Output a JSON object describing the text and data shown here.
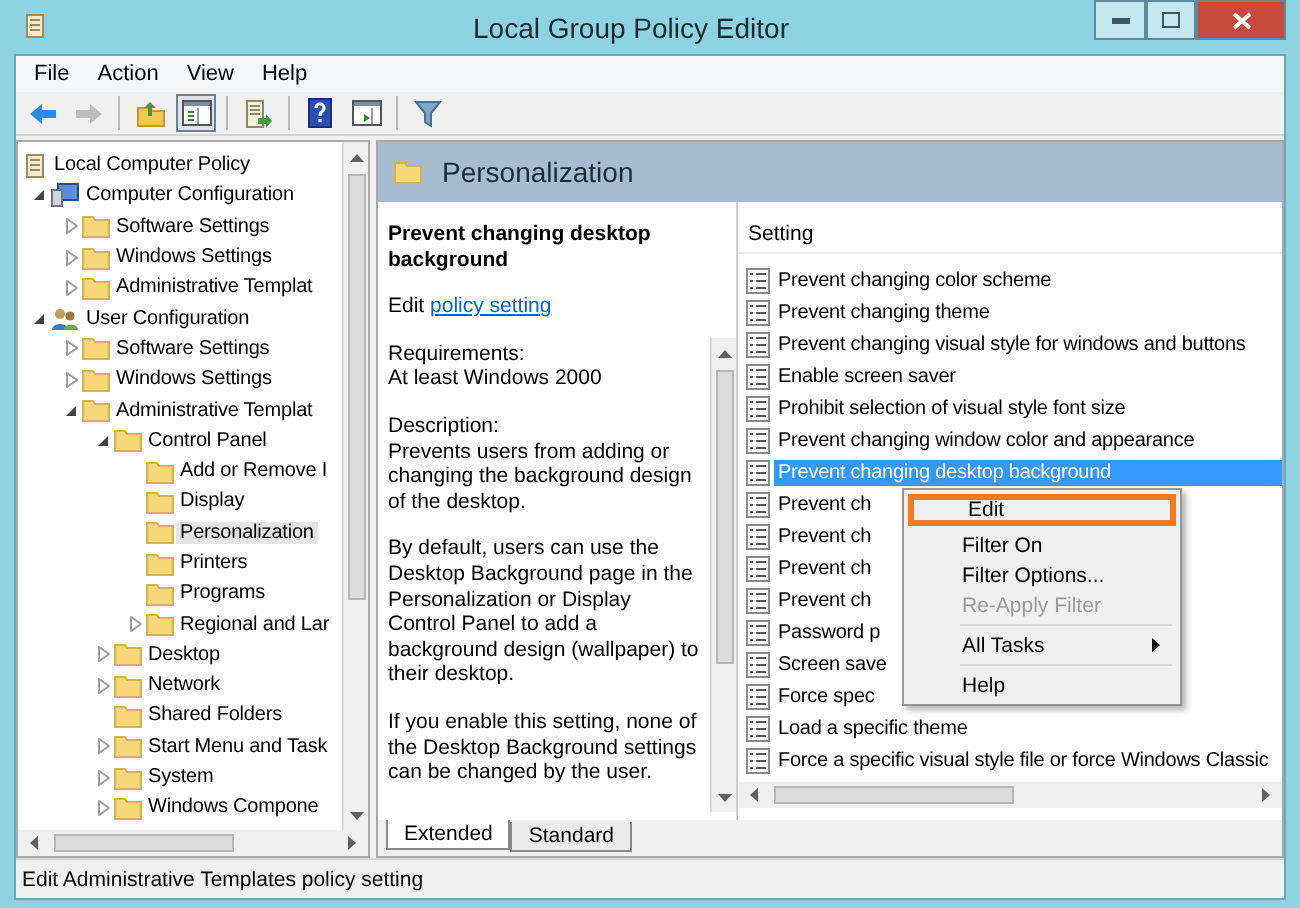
{
  "window": {
    "title": "Local Group Policy Editor"
  },
  "menu_bar": [
    "File",
    "Action",
    "View",
    "Help"
  ],
  "toolbar": [
    {
      "kind": "back",
      "disabled": false
    },
    {
      "kind": "forward",
      "disabled": true
    },
    {
      "kind": "separator"
    },
    {
      "kind": "up",
      "disabled": false
    },
    {
      "kind": "tree",
      "disabled": false,
      "selected": true
    },
    {
      "kind": "separator"
    },
    {
      "kind": "export",
      "disabled": false
    },
    {
      "kind": "separator"
    },
    {
      "kind": "help",
      "disabled": false
    },
    {
      "kind": "pane",
      "disabled": false
    },
    {
      "kind": "separator"
    },
    {
      "kind": "filter",
      "disabled": false
    }
  ],
  "tree": [
    {
      "label": "Local Computer Policy",
      "kind": "policy",
      "selected": false,
      "children": [
        {
          "label": "Computer Configuration",
          "kind": "computer",
          "expanded": true,
          "selected": false,
          "children": [
            {
              "label": "Software Settings",
              "kind": "folder",
              "expanded": false,
              "selected": false
            },
            {
              "label": "Windows Settings",
              "kind": "folder",
              "expanded": false,
              "selected": false
            },
            {
              "label": "Administrative Templat",
              "kind": "folder",
              "expanded": false,
              "selected": false
            }
          ]
        },
        {
          "label": "User Configuration",
          "kind": "user",
          "expanded": true,
          "selected": false,
          "children": [
            {
              "label": "Software Settings",
              "kind": "folder",
              "expanded": false,
              "selected": false
            },
            {
              "label": "Windows Settings",
              "kind": "folder",
              "expanded": false,
              "selected": false
            },
            {
              "label": "Administrative Templat",
              "kind": "folder",
              "expanded": true,
              "selected": false,
              "children": [
                {
                  "label": "Control Panel",
                  "kind": "folder",
                  "expanded": true,
                  "selected": false,
                  "children": [
                    {
                      "label": "Add or Remove I",
                      "kind": "folder",
                      "selected": false
                    },
                    {
                      "label": "Display",
                      "kind": "folder",
                      "selected": false
                    },
                    {
                      "label": "Personalization",
                      "kind": "folder",
                      "selected": true
                    },
                    {
                      "label": "Printers",
                      "kind": "folder",
                      "selected": false
                    },
                    {
                      "label": "Programs",
                      "kind": "folder",
                      "selected": false
                    },
                    {
                      "label": "Regional and Lar",
                      "kind": "folder",
                      "expanded": false,
                      "selected": false
                    }
                  ]
                },
                {
                  "label": "Desktop",
                  "kind": "folder",
                  "expanded": false,
                  "selected": false
                },
                {
                  "label": "Network",
                  "kind": "folder",
                  "expanded": false,
                  "selected": false
                },
                {
                  "label": "Shared Folders",
                  "kind": "folder",
                  "selected": false
                },
                {
                  "label": "Start Menu and Task",
                  "kind": "folder",
                  "expanded": false,
                  "selected": false
                },
                {
                  "label": "System",
                  "kind": "folder",
                  "expanded": false,
                  "selected": false
                },
                {
                  "label": "Windows Compone",
                  "kind": "folder",
                  "expanded": false,
                  "selected": false
                }
              ]
            }
          ]
        }
      ]
    }
  ],
  "header": {
    "title": "Personalization"
  },
  "details": {
    "title": "Prevent changing desktop background",
    "edit_prefix": "Edit",
    "link": "policy setting",
    "paragraphs": [
      "Requirements:\nAt least Windows 2000",
      "Description:\nPrevents users from adding or changing the background design of the desktop.",
      "By default, users can use the Desktop Background page in the Personalization or Display Control Panel to add a background design (wallpaper) to their desktop.",
      "If you enable this setting, none of the Desktop Background settings can be changed by the user."
    ]
  },
  "settings": {
    "column": "Setting",
    "rows": [
      {
        "label": "Prevent changing color scheme",
        "selected": false
      },
      {
        "label": "Prevent changing theme",
        "selected": false
      },
      {
        "label": "Prevent changing visual style for windows and buttons",
        "selected": false
      },
      {
        "label": "Enable screen saver",
        "selected": false
      },
      {
        "label": "Prohibit selection of visual style font size",
        "selected": false
      },
      {
        "label": "Prevent changing window color and appearance",
        "selected": false
      },
      {
        "label": "Prevent changing desktop background",
        "selected": true
      },
      {
        "label": "Prevent ch",
        "selected": false
      },
      {
        "label": "Prevent ch",
        "selected": false
      },
      {
        "label": "Prevent ch",
        "selected": false
      },
      {
        "label": "Prevent ch",
        "selected": false
      },
      {
        "label": "Password p",
        "selected": false
      },
      {
        "label": "Screen save",
        "selected": false
      },
      {
        "label": "Force spec",
        "selected": false
      },
      {
        "label": "Load a specific theme",
        "selected": false
      },
      {
        "label": "Force a specific visual style file or force Windows Classic",
        "selected": false
      }
    ]
  },
  "context_menu": [
    {
      "kind": "item",
      "label": "Edit",
      "selected": true,
      "disabled": false
    },
    {
      "kind": "item",
      "label": "Filter On",
      "selected": false,
      "disabled": false
    },
    {
      "kind": "item",
      "label": "Filter Options...",
      "selected": false,
      "disabled": false
    },
    {
      "kind": "item",
      "label": "Re-Apply Filter",
      "selected": false,
      "disabled": true
    },
    {
      "kind": "separator"
    },
    {
      "kind": "submenu",
      "label": "All Tasks",
      "selected": false,
      "disabled": false
    },
    {
      "kind": "separator"
    },
    {
      "kind": "item",
      "label": "Help",
      "selected": false,
      "disabled": false
    }
  ],
  "view_tabs": [
    {
      "label": "Extended",
      "selected": true
    },
    {
      "label": "Standard",
      "selected": false
    }
  ],
  "status_bar": "Edit Administrative Templates policy setting"
}
